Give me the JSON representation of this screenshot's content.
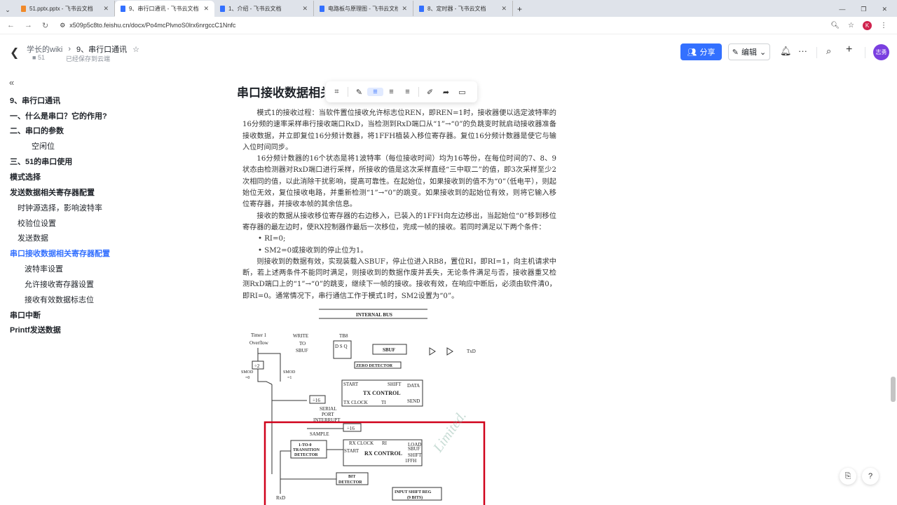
{
  "browser": {
    "tabs": [
      {
        "label": "51.pptx.pptx - 飞书云文档",
        "icon": "pptx-icon"
      },
      {
        "label": "9、串行口通讯 - 飞书云文档",
        "icon": "doc-icon",
        "active": true
      },
      {
        "label": "1、介绍 - 飞书云文档",
        "icon": "doc-icon"
      },
      {
        "label": "电路板与原理图 - 飞书云文档",
        "icon": "doc-icon"
      },
      {
        "label": "8、定时器 - 飞书云文档",
        "icon": "doc-icon"
      }
    ],
    "url": "x509p5c8to.feishu.cn/docx/Po4mcPlvnoS0lrx6nrgccC1Nnfc",
    "profile": "K"
  },
  "header": {
    "breadcrumb_root": "学长的wiki",
    "breadcrumb_current": "9、串行口通讯",
    "space_count": "51",
    "save_status": "已经保存到云端",
    "share_label": "分享",
    "edit_label": "编辑",
    "avatar": "志勇"
  },
  "sidebar": {
    "items": [
      {
        "label": "9、串行口通讯"
      },
      {
        "label": "一、什么是串口？它的作用?"
      },
      {
        "label": "二、串口的参数"
      },
      {
        "label": "空闲位"
      },
      {
        "label": "三、51的串口使用"
      },
      {
        "label": "模式选择"
      },
      {
        "label": "发送数据相关寄存器配置"
      },
      {
        "label": "时钟源选择，影响波特率"
      },
      {
        "label": "校验位设置"
      },
      {
        "label": "发送数据"
      },
      {
        "label": "串口接收数据相关寄存器配置"
      },
      {
        "label": "波特率设置"
      },
      {
        "label": "允许接收寄存器设置"
      },
      {
        "label": "接收有效数据标志位"
      },
      {
        "label": "串口中断"
      },
      {
        "label": "Printf发送数据"
      }
    ]
  },
  "doc": {
    "heading": "串口接收数据相关寄存器配置",
    "paragraphs": [
      "模式1的接收过程：当软件置位接收允许标志位REN，即REN=1时，接收器便以选定波特率的16分频的速率采样串行接收端口RxD，当检测到RxD端口从“1”→“0”的负跳变时就启动接收器准备接收数据，并立即复位16分频计数器，将1FFH植装入移位寄存器。复位16分频计数器是使它与输入位时间同步。",
      "16分频计数器的16个状态是将1波特率（每位接收时间）均为16等份，在每位时间的7、8、9状态由检测器对RxD端口进行采样，所接收的值是这次采样直经“三中取二”的值，即3次采样至少2次相同的值，以此消除干扰影响，提高可靠性。在起始位，如果接收到的值不为“0”（低电平），则起始位无效，复位接收电路，并重新检测“1”→“0”的跳变。如果接收到的起始位有效，则将它输入移位寄存器，并接收本帧的其余信息。",
      "接收的数据从接收移位寄存器的右边移入，已装入的1FFH向左边移出，当起始位“0”移到移位寄存器的最左边时，使RX控制器作最后一次移位，完成一帧的接收。若同时满足以下两个条件："
    ],
    "bullets": [
      "• RI=0;",
      "• SM2=0或接收到的停止位为1。"
    ],
    "paragraph_last": "则接收到的数据有效，实现装载入SBUF，停止位进入RB8，置位RI，即RI=1，向主机请求中断，若上述两条件不能同时满足，则接收到的数据作废并丢失，无论条件满足与否，接收器重又检测RxD端口上的“1”→“0”的跳变，继续下一帧的接收。接收有效，在响应中断后，必须由软件清0，即RI=0。通常情况下，串行通信工作于模式1时，SM2设置为“0”。"
  },
  "diagram": {
    "internal_bus": "INTERNAL BUS",
    "tb8": "TB8",
    "timer1": "Timer 1",
    "overflow": "Overflow",
    "write": "WRITE",
    "to": "TO",
    "sbuf_in": "SBUF",
    "sbuf": "SBUF",
    "zero_detector": "ZERO DETECTOR",
    "div2": "÷2",
    "smod0": "SMOD",
    "smod0v": "=0",
    "smod1": "SMOD",
    "smod1v": "=1",
    "txd": "TxD",
    "start": "START",
    "shift": "SHIFT",
    "data": "DATA",
    "tx_control": "TX CONTROL",
    "div16": "÷16",
    "tx_clock": "TX CLOCK",
    "ti": "TI",
    "send": "SEND",
    "serial": "SERIAL",
    "port": "PORT",
    "interrupt": "INTERRUPT",
    "div16b": "÷16",
    "sample": "SAMPLE",
    "transition1": "1-TO-0",
    "transition2": "TRANSITION",
    "transition3": "DETECTOR",
    "rx_clock": "RX CLOCK",
    "ri": "RI",
    "rx_start": "START",
    "rx_control": "RX CONTROL",
    "load": "LOAD",
    "load_sbuf": "SBUF",
    "rx_shift": "SHIFT",
    "ffh": "1FFH",
    "bit": "BIT",
    "detector": "DETECTOR",
    "rxd": "RxD",
    "isr1": "INPUT SHIFT REG",
    "isr2": "(9 BITS)"
  }
}
